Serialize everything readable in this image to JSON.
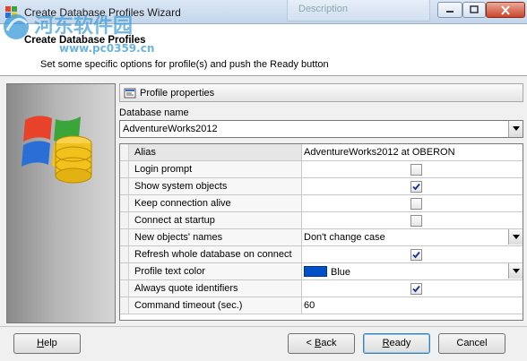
{
  "window": {
    "title": "Create Database Profiles Wizard",
    "background_tab": "Description"
  },
  "watermark": {
    "brand": "河东软件园",
    "url": "www.pc0359.cn"
  },
  "header": {
    "title": "Create Database Profiles",
    "subtitle": "Set some specific options for profile(s) and push the Ready button"
  },
  "group": {
    "title": "Profile properties"
  },
  "database": {
    "label": "Database name",
    "value": "AdventureWorks2012"
  },
  "properties": [
    {
      "name": "Alias",
      "type": "text",
      "value": "AdventureWorks2012 at OBERON"
    },
    {
      "name": "Login prompt",
      "type": "checkbox",
      "checked": false
    },
    {
      "name": "Show system objects",
      "type": "checkbox",
      "checked": true
    },
    {
      "name": "Keep connection alive",
      "type": "checkbox",
      "checked": false
    },
    {
      "name": "Connect at startup",
      "type": "checkbox",
      "checked": false
    },
    {
      "name": "New objects' names",
      "type": "dropdown",
      "value": "Don't change case"
    },
    {
      "name": "Refresh whole database on connect",
      "type": "checkbox",
      "checked": true
    },
    {
      "name": "Profile text color",
      "type": "color",
      "value": "Blue",
      "color": "#0050c8"
    },
    {
      "name": "Always quote identifiers",
      "type": "checkbox",
      "checked": true
    },
    {
      "name": "Command timeout (sec.)",
      "type": "text",
      "value": "60"
    }
  ],
  "buttons": {
    "help": {
      "label": "Help",
      "hotkey_index": 0
    },
    "back": {
      "label": "< Back",
      "hotkey_index": 2
    },
    "ready": {
      "label": "Ready",
      "hotkey_index": 0
    },
    "cancel": {
      "label": "Cancel"
    }
  }
}
